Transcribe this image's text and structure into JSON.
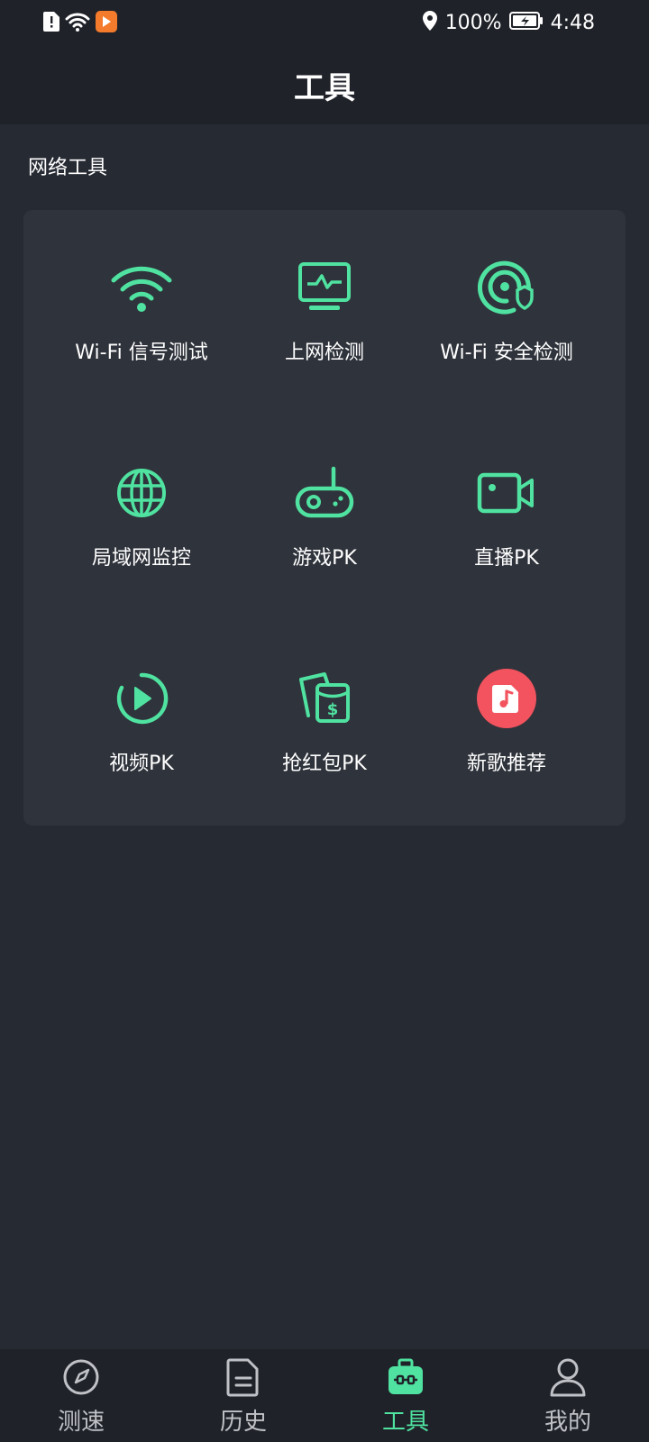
{
  "status_bar": {
    "battery_percent": "100%",
    "time": "4:48"
  },
  "header": {
    "title": "工具"
  },
  "section": {
    "title": "网络工具"
  },
  "tools": [
    {
      "label": "Wi-Fi 信号测试",
      "icon": "wifi-icon"
    },
    {
      "label": "上网检测",
      "icon": "monitor-icon"
    },
    {
      "label": "Wi-Fi 安全检测",
      "icon": "wifi-shield-icon"
    },
    {
      "label": "局域网监控",
      "icon": "globe-icon"
    },
    {
      "label": "游戏PK",
      "icon": "gamepad-icon"
    },
    {
      "label": "直播PK",
      "icon": "video-camera-icon"
    },
    {
      "label": "视频PK",
      "icon": "play-circle-icon"
    },
    {
      "label": "抢红包PK",
      "icon": "red-packet-icon"
    },
    {
      "label": "新歌推荐",
      "icon": "music-icon"
    }
  ],
  "bottom_nav": {
    "items": [
      {
        "label": "测速",
        "icon": "speedometer-icon",
        "active": false
      },
      {
        "label": "历史",
        "icon": "document-icon",
        "active": false
      },
      {
        "label": "工具",
        "icon": "toolbox-icon",
        "active": true
      },
      {
        "label": "我的",
        "icon": "user-icon",
        "active": false
      }
    ]
  },
  "colors": {
    "accent": "#4fe2a0",
    "background": "#262a33",
    "card": "#2f333b",
    "bar": "#1f2229",
    "music_badge": "#f2535e"
  }
}
